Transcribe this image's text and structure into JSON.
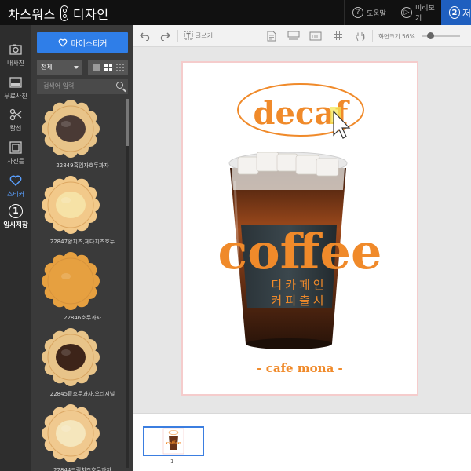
{
  "header": {
    "brand_left": "차스워스",
    "brand_right": "디자인",
    "help": "도움말",
    "preview": "미리보기",
    "save_step": "2",
    "save_label": "저"
  },
  "rail": {
    "items": [
      {
        "label": "내사진",
        "icon": "camera-icon"
      },
      {
        "label": "무료사진",
        "icon": "free-photo-icon"
      },
      {
        "label": "칼선",
        "icon": "scissors-icon"
      },
      {
        "label": "사진틀",
        "icon": "frame-icon"
      },
      {
        "label": "스티커",
        "icon": "heart-icon",
        "active": true
      },
      {
        "label": "임시저장",
        "icon": "step-one-icon",
        "num": "1"
      }
    ]
  },
  "panel": {
    "my_sticker_label": "마이스티커",
    "filter_value": "전체",
    "search_placeholder": "검색어 입력",
    "stickers": [
      {
        "caption": "22849흑임자호두과자",
        "filling": "#4a3a35",
        "ring": "#e8c489"
      },
      {
        "caption": "22847황치즈,체다치즈호두",
        "filling": "#f6e2a6",
        "ring": "#f2c98a"
      },
      {
        "caption": "22846호두과자",
        "filling": "#e6a040",
        "ring": "#e6a040"
      },
      {
        "caption": "22845팥호두과자,오리지널",
        "filling": "#3d2419",
        "ring": "#e8c489"
      },
      {
        "caption": "22844크림치즈호두과자",
        "filling": "#f5e6bc",
        "ring": "#f0c98f"
      }
    ]
  },
  "toolbar": {
    "text_tool": "글쓰기",
    "zoom_label": "화면크기 56%",
    "zoom_percent": 56
  },
  "design": {
    "badge_text": "decaf",
    "title": "coffee",
    "korean_line1": "디카페인",
    "korean_line2": "커피출시",
    "footer": "- cafe mona -",
    "accent": "#f08a2a"
  },
  "thumbnails": {
    "pages": [
      "1"
    ],
    "thumb_text": "coffee"
  }
}
